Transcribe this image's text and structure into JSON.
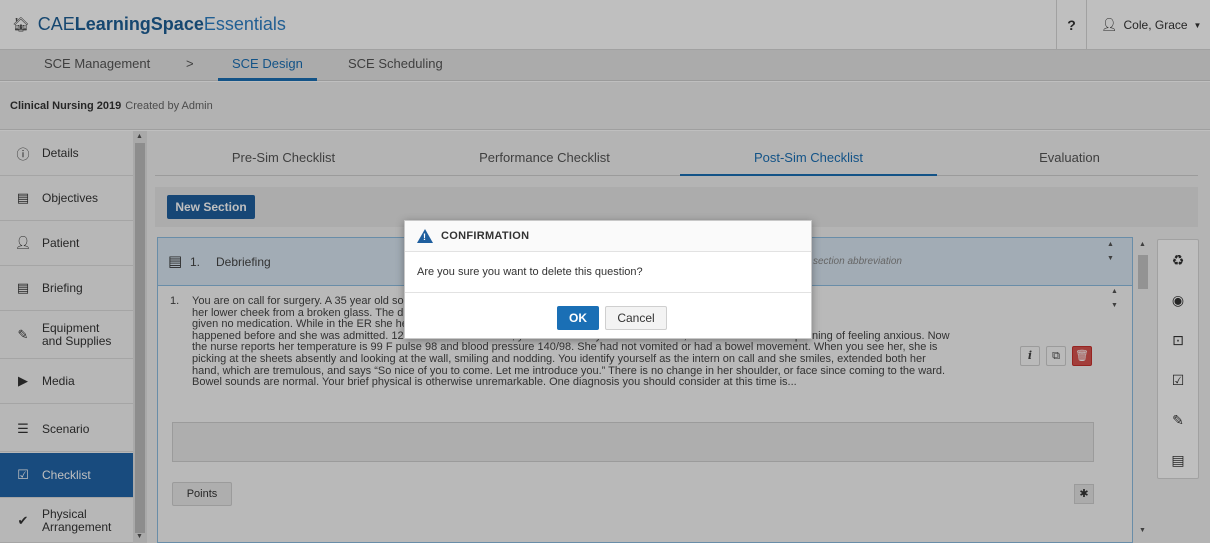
{
  "app": {
    "brand_prefix": "CAE",
    "brand_bold": "LearningSpace",
    "brand_suffix": "Essentials",
    "help_label": "?",
    "user_name": "Cole, Grace"
  },
  "nav": {
    "items": [
      {
        "label": "SCE Management"
      },
      {
        "label": ">"
      },
      {
        "label": "SCE Design"
      },
      {
        "label": "SCE Scheduling"
      }
    ]
  },
  "breadcrumb": {
    "title": "Clinical Nursing 2019",
    "meta": "Created by Admin"
  },
  "sidebar": {
    "items": [
      {
        "label": "Details"
      },
      {
        "label": "Objectives"
      },
      {
        "label": "Patient"
      },
      {
        "label": "Briefing"
      },
      {
        "label": "Equipment and Supplies"
      },
      {
        "label": "Media"
      },
      {
        "label": "Scenario"
      },
      {
        "label": "Checklist"
      },
      {
        "label": "Physical Arrangement"
      }
    ],
    "active_index": 7
  },
  "tabs": [
    {
      "label": "Pre-Sim Checklist"
    },
    {
      "label": "Performance Checklist"
    },
    {
      "label": "Post-Sim Checklist"
    },
    {
      "label": "Evaluation"
    }
  ],
  "toolbar": {
    "new_section_label": "New Section"
  },
  "section": {
    "number": "1.",
    "title": "Debriefing",
    "abbreviation_placeholder": "section abbreviation",
    "question_number": "1.",
    "question_lines": [
      "You are on call for surgery. A 35 year old                                                                                                              so had a shallow jagged cut on",
      "her lower cheek from a broken glass. The                                                                                                           d her vitals were stable. She was",
      "given no medication. While in the ER she                                                                                                          he positive. This had never",
      "happened before and she was admitted. 12 hours after admission, you are called by the ward. Earlier, Mrs. Nettles was complaining of feeling anxious. Now",
      "the nurse reports her temperature is 99 F pulse 98 and blood pressure 140/98. She had not vomited or had a bowel movement. When you see her, she is",
      "picking at the sheets absently and looking at the wall, smiling and nodding. You identify yourself as the intern on call and she smiles, extended both her",
      "hand, which are tremulous, and says “So nice of you to come. Let me introduce you.” There is no change in her shoulder, or face since coming to the ward.",
      "Bowel sounds are normal. Your brief physical is otherwise unremarkable. One diagnosis you should consider at this time is..."
    ],
    "points_label": "Points",
    "star_label": "✱"
  },
  "modal": {
    "title": "CONFIRMATION",
    "message": "Are you sure you want to delete this question?",
    "ok_label": "OK",
    "cancel_label": "Cancel"
  },
  "colors": {
    "primary": "#1f5f9e",
    "active_tab": "#1a6fb5",
    "danger": "#d9534f"
  }
}
